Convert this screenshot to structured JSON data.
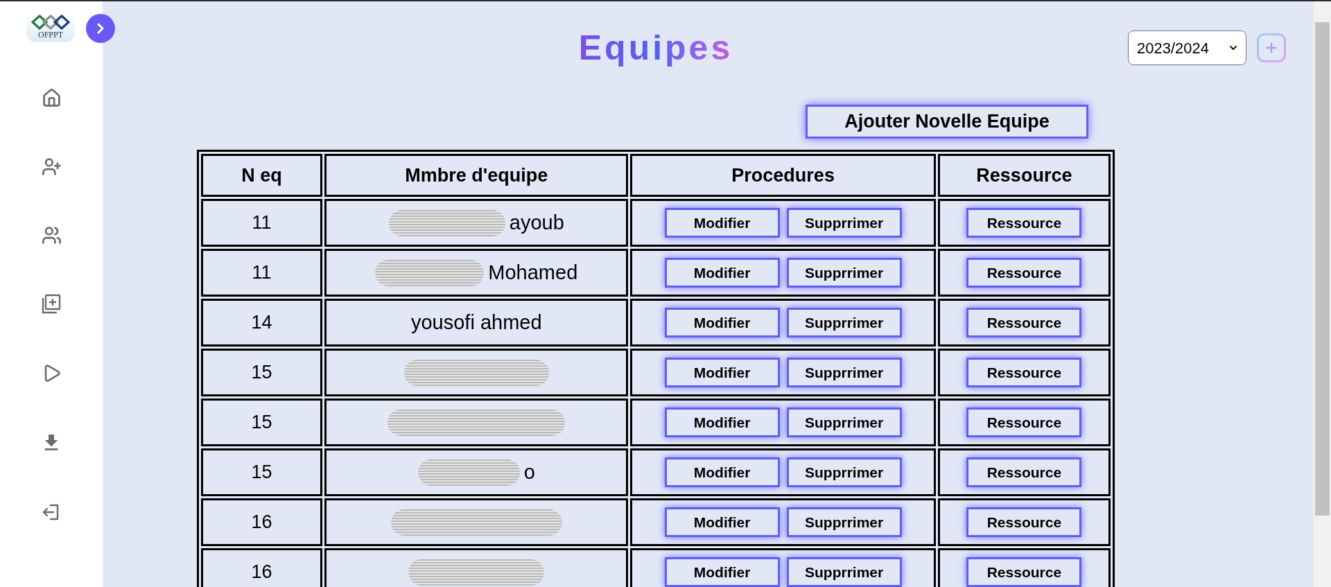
{
  "sidebar": {
    "logo_text": "OFPPT",
    "expanded": false
  },
  "header": {
    "title": "Equipes",
    "year_select": {
      "value": "2023/2024"
    }
  },
  "add_team_button": "Ajouter Novelle Equipe",
  "table": {
    "columns": [
      "N eq",
      "Mmbre d'equipe",
      "Procedures",
      "Ressource"
    ],
    "rows": [
      {
        "n_eq": "11",
        "member": {
          "redacted": true,
          "text": "ayoub"
        },
        "actions": [
          "Modifier",
          "Supprrimer"
        ],
        "resource": "Ressource"
      },
      {
        "n_eq": "11",
        "member": {
          "redacted": true,
          "text": "Mohamed"
        },
        "actions": [
          "Modifier",
          "Supprrimer"
        ],
        "resource": "Ressource"
      },
      {
        "n_eq": "14",
        "member": {
          "redacted": false,
          "text": "yousofi ahmed"
        },
        "actions": [
          "Modifier",
          "Supprrimer"
        ],
        "resource": "Ressource"
      },
      {
        "n_eq": "15",
        "member": {
          "redacted": true
        },
        "actions": [
          "Modifier",
          "Supprrimer"
        ],
        "resource": "Ressource"
      },
      {
        "n_eq": "15",
        "member": {
          "redacted": true
        },
        "actions": [
          "Modifier",
          "Supprrimer"
        ],
        "resource": "Ressource"
      },
      {
        "n_eq": "15",
        "member": {
          "redacted": true,
          "text": "o"
        },
        "actions": [
          "Modifier",
          "Supprrimer"
        ],
        "resource": "Ressource"
      },
      {
        "n_eq": "16",
        "member": {
          "redacted": true
        },
        "actions": [
          "Modifier",
          "Supprrimer"
        ],
        "resource": "Ressource"
      },
      {
        "n_eq": "16",
        "member": {
          "redacted": true
        },
        "actions": [
          "Modifier",
          "Supprrimer"
        ],
        "resource": "Ressource"
      }
    ]
  }
}
